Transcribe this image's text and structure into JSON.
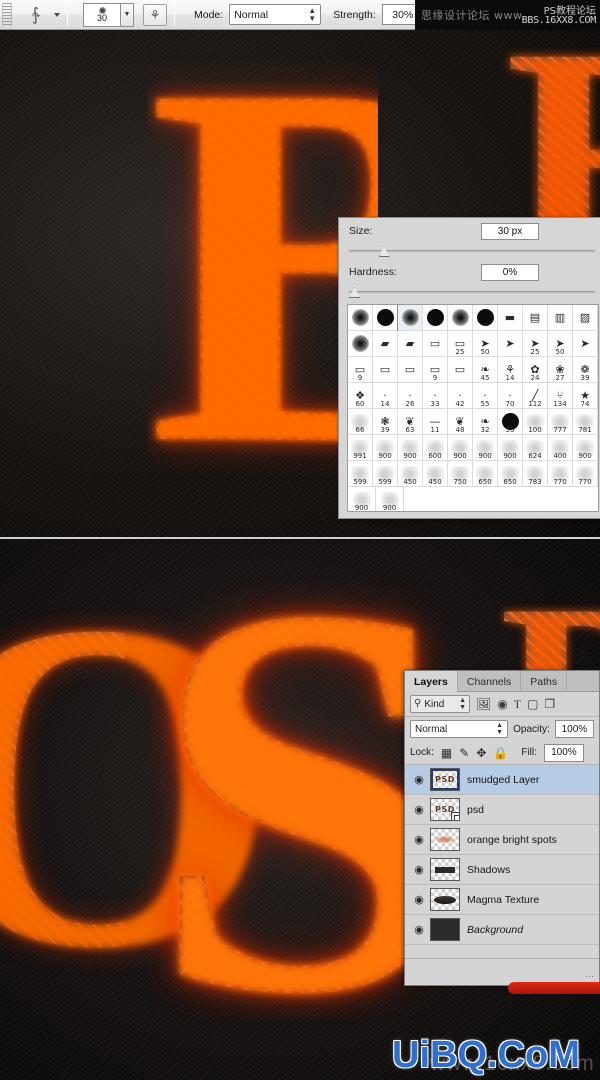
{
  "options_bar": {
    "tool_icon": "smudge-tool-icon",
    "tool_preset_caret": "▾",
    "brush_size_value": "30",
    "airbrush_toggle_icon": "⚘",
    "mode_label": "Mode:",
    "mode_value": "Normal",
    "strength_label": "Strength:",
    "strength_value": "30%",
    "dropdown_caret": "▾",
    "spin_caret": "▾"
  },
  "watermark_top": {
    "line1": "思缘设计论坛 www.",
    "line2": "PS教程论坛",
    "line3": "BBS.16XX8.COM"
  },
  "watermark_bottom": {
    "text": "UiBQ.CoM",
    "ghost": "www.16xx8.com"
  },
  "brush_panel": {
    "size_label": "Size:",
    "size_value": "30 px",
    "hardness_label": "Hardness:",
    "hardness_value": "0%",
    "size_slider_pos_pct": 12,
    "hardness_slider_pos_pct": 0,
    "grid_rows": [
      [
        {
          "type": "soft",
          "num": ""
        },
        {
          "type": "hard",
          "num": ""
        },
        {
          "type": "soft",
          "num": "",
          "selected": true
        },
        {
          "type": "hard",
          "num": ""
        },
        {
          "type": "soft",
          "num": ""
        },
        {
          "type": "hard",
          "num": ""
        },
        {
          "type": "glyph",
          "glyph": "▬",
          "num": ""
        },
        {
          "type": "glyph",
          "glyph": "▤",
          "num": ""
        },
        {
          "type": "glyph",
          "glyph": "▥",
          "num": ""
        },
        {
          "type": "glyph",
          "glyph": "▨",
          "num": ""
        }
      ],
      [
        {
          "type": "soft",
          "num": ""
        },
        {
          "type": "glyph",
          "glyph": "▰",
          "num": ""
        },
        {
          "type": "glyph",
          "glyph": "▰",
          "num": ""
        },
        {
          "type": "glyph",
          "glyph": "▭",
          "num": ""
        },
        {
          "type": "glyph",
          "glyph": "▭",
          "num": "25"
        },
        {
          "type": "glyph",
          "glyph": "➤",
          "num": "50"
        },
        {
          "type": "glyph",
          "glyph": "➤",
          "num": ""
        },
        {
          "type": "glyph",
          "glyph": "➤",
          "num": "25"
        },
        {
          "type": "glyph",
          "glyph": "➤",
          "num": "50"
        },
        {
          "type": "glyph",
          "glyph": "➤",
          "num": ""
        }
      ],
      [
        {
          "type": "glyph",
          "glyph": "▭",
          "num": "9"
        },
        {
          "type": "glyph",
          "glyph": "▭",
          "num": ""
        },
        {
          "type": "glyph",
          "glyph": "▭",
          "num": ""
        },
        {
          "type": "glyph",
          "glyph": "▭",
          "num": "9"
        },
        {
          "type": "glyph",
          "glyph": "▭",
          "num": ""
        },
        {
          "type": "glyph",
          "glyph": "❧",
          "num": "45"
        },
        {
          "type": "glyph",
          "glyph": "⚘",
          "num": "14"
        },
        {
          "type": "glyph",
          "glyph": "✿",
          "num": "24"
        },
        {
          "type": "glyph",
          "glyph": "❀",
          "num": "27"
        },
        {
          "type": "glyph",
          "glyph": "❁",
          "num": "39"
        }
      ],
      [
        {
          "type": "glyph",
          "glyph": "❖",
          "num": "60"
        },
        {
          "type": "dot",
          "num": "14"
        },
        {
          "type": "dot",
          "num": "26"
        },
        {
          "type": "dot",
          "num": "33"
        },
        {
          "type": "dot",
          "num": "42"
        },
        {
          "type": "dot",
          "num": "55"
        },
        {
          "type": "dot",
          "num": "70"
        },
        {
          "type": "glyph",
          "glyph": "╱",
          "num": "112"
        },
        {
          "type": "glyph",
          "glyph": "⑂",
          "num": "134"
        },
        {
          "type": "glyph",
          "glyph": "★",
          "num": "74"
        }
      ],
      [
        {
          "type": "faint",
          "num": "66"
        },
        {
          "type": "glyph",
          "glyph": "❃",
          "num": "39"
        },
        {
          "type": "glyph",
          "glyph": "❦",
          "num": "63"
        },
        {
          "type": "glyph",
          "glyph": "—",
          "num": "11"
        },
        {
          "type": "glyph",
          "glyph": "❦",
          "num": "48"
        },
        {
          "type": "glyph",
          "glyph": "❧",
          "num": "32"
        },
        {
          "type": "hard",
          "num": "55"
        },
        {
          "type": "faint",
          "num": "100"
        },
        {
          "type": "faint",
          "num": "777"
        },
        {
          "type": "faint",
          "num": "781"
        }
      ],
      [
        {
          "type": "faint",
          "num": "991"
        },
        {
          "type": "faint",
          "num": "900"
        },
        {
          "type": "faint",
          "num": "900"
        },
        {
          "type": "faint",
          "num": "600"
        },
        {
          "type": "faint",
          "num": "900"
        },
        {
          "type": "faint",
          "num": "900"
        },
        {
          "type": "faint",
          "num": "900"
        },
        {
          "type": "faint",
          "num": "624"
        },
        {
          "type": "faint",
          "num": "400"
        },
        {
          "type": "faint",
          "num": "900"
        }
      ],
      [
        {
          "type": "faint",
          "num": "599"
        },
        {
          "type": "faint",
          "num": "599"
        },
        {
          "type": "faint",
          "num": "450"
        },
        {
          "type": "faint",
          "num": "450"
        },
        {
          "type": "faint",
          "num": "750"
        },
        {
          "type": "faint",
          "num": "650"
        },
        {
          "type": "faint",
          "num": "650"
        },
        {
          "type": "faint",
          "num": "783"
        },
        {
          "type": "faint",
          "num": "770"
        },
        {
          "type": "faint",
          "num": "770"
        }
      ],
      [
        {
          "type": "faint",
          "num": "900"
        },
        {
          "type": "faint",
          "num": "900"
        }
      ]
    ]
  },
  "layers_panel": {
    "tabs": [
      {
        "label": "Layers",
        "active": true
      },
      {
        "label": "Channels",
        "active": false
      },
      {
        "label": "Paths",
        "active": false
      }
    ],
    "filter": {
      "search_icon": "⚲",
      "kind_label": "Kind",
      "icons": [
        "image-filter-icon",
        "adjustment-filter-icon",
        "type-filter-icon",
        "shape-filter-icon",
        "smartobject-filter-icon"
      ]
    },
    "blend_mode": "Normal",
    "opacity_label": "Opacity:",
    "opacity_value": "100%",
    "lock_label": "Lock:",
    "lock_icons": [
      "lock-transparent-icon",
      "lock-image-icon",
      "lock-position-icon",
      "lock-all-icon"
    ],
    "fill_label": "Fill:",
    "fill_value": "100%",
    "layers": [
      {
        "name": "smudged Layer",
        "selected": true,
        "thumb": "psd-text",
        "visible": true,
        "italic": false,
        "smart_badge": false
      },
      {
        "name": "psd",
        "selected": false,
        "thumb": "psd-text",
        "visible": true,
        "italic": false,
        "smart_badge": true
      },
      {
        "name": "orange bright spots",
        "selected": false,
        "thumb": "orange-blob",
        "visible": true,
        "italic": false,
        "smart_badge": false
      },
      {
        "name": "Shadows",
        "selected": false,
        "thumb": "dark-dots",
        "visible": true,
        "italic": false,
        "smart_badge": false
      },
      {
        "name": "Magma Texture",
        "selected": false,
        "thumb": "magma",
        "visible": true,
        "italic": false,
        "smart_badge": false
      },
      {
        "name": "Background",
        "selected": false,
        "thumb": "solid-dark",
        "visible": true,
        "italic": true,
        "smart_badge": false
      }
    ],
    "eye_icon": "◉",
    "footer_grip": "⋯"
  },
  "canvas": {
    "top_letters": {
      "main": "B",
      "right": "B"
    },
    "bottom_letters": {
      "main": "S",
      "left": "O",
      "right": "B"
    }
  },
  "colors": {
    "lava_orange": "#ff5a00",
    "lava_yellow": "#ffb347",
    "panel_gray": "#d4d4d4",
    "selection_blue": "#b6cbe4",
    "watermark_blue": "#2f6fd0"
  }
}
